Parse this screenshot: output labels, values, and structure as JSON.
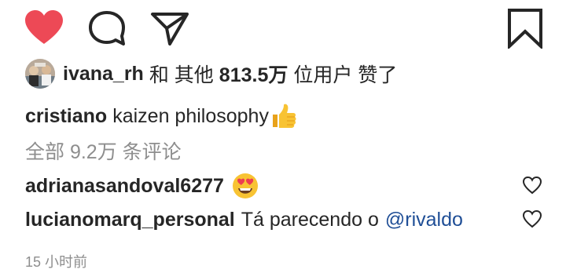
{
  "colors": {
    "like_red": "#ed4956",
    "text_primary": "#262626",
    "text_secondary": "#8e8e8e",
    "mention_blue": "#1f4e96"
  },
  "actions": {
    "like_icon": "heart-icon",
    "comment_icon": "comment-icon",
    "share_icon": "share-icon",
    "save_icon": "bookmark-icon"
  },
  "likes": {
    "username": "ivana_rh",
    "connector": "和 其他",
    "count": "813.5万",
    "suffix": "位用户 赞了"
  },
  "caption": {
    "username": "cristiano",
    "text": "kaizen philosophy",
    "emoji": "thumbs-up"
  },
  "view_all_comments": "全部 9.2万 条评论",
  "comments": [
    {
      "username": "adrianasandoval6277",
      "text": "",
      "emoji": "heart-eyes"
    },
    {
      "username": "lucianomarq_personal",
      "text": "Tá parecendo o",
      "mention": "@rivaldo"
    }
  ],
  "timestamp": "15 小时前"
}
